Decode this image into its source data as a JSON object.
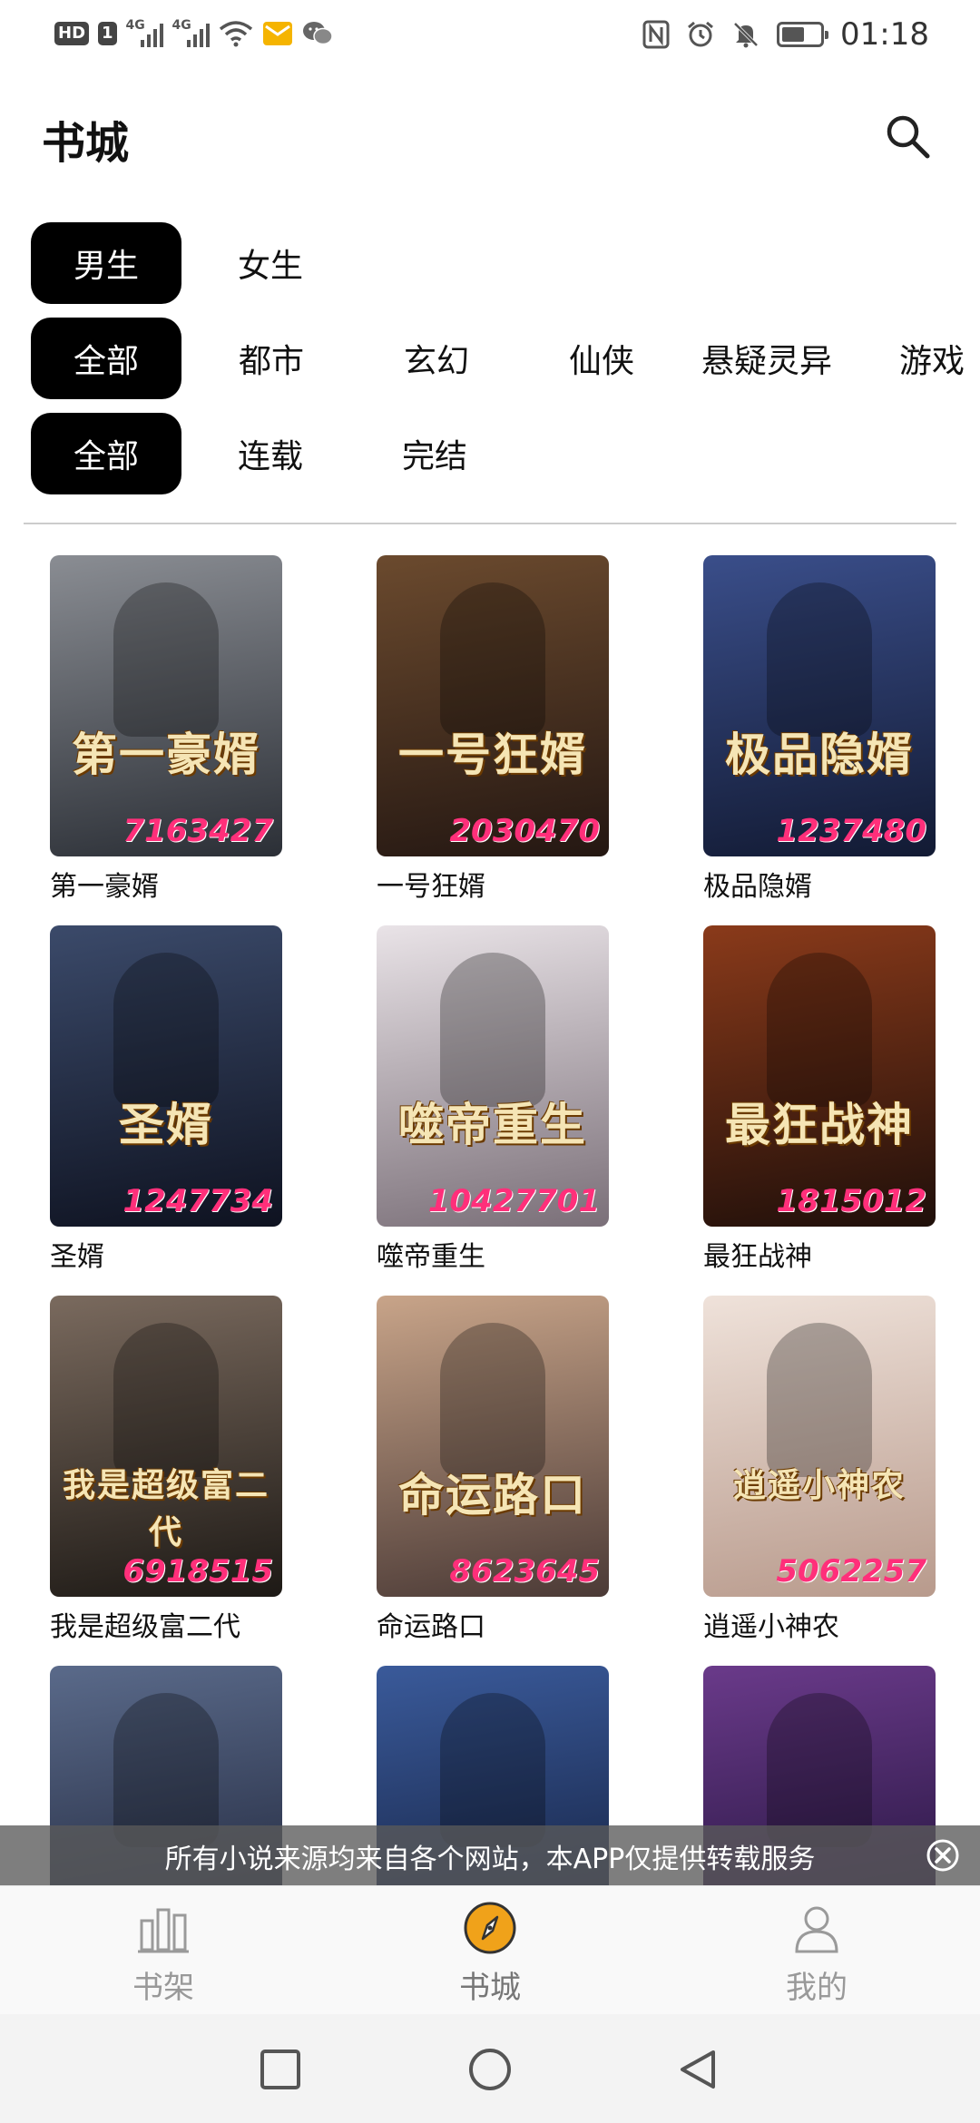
{
  "status_bar": {
    "left_badges": [
      "HD",
      "1"
    ],
    "signal_label": "4G",
    "time": "01:18",
    "icons": [
      "nfc-icon",
      "alarm-icon",
      "mute-bell-icon",
      "battery-icon"
    ],
    "battery_level": 0.6
  },
  "header": {
    "title": "书城",
    "search_icon": "search-icon"
  },
  "filters": {
    "gender": [
      {
        "label": "男生",
        "active": true
      },
      {
        "label": "女生",
        "active": false
      }
    ],
    "category": [
      {
        "label": "全部",
        "active": true
      },
      {
        "label": "都市",
        "active": false
      },
      {
        "label": "玄幻",
        "active": false
      },
      {
        "label": "仙侠",
        "active": false
      },
      {
        "label": "悬疑灵异",
        "active": false
      },
      {
        "label": "游戏",
        "active": false
      }
    ],
    "status": [
      {
        "label": "全部",
        "active": true
      },
      {
        "label": "连载",
        "active": false
      },
      {
        "label": "完结",
        "active": false
      }
    ]
  },
  "books": [
    {
      "title": "第一豪婿",
      "cover_title": "第一豪婿",
      "cover_id": "7163427",
      "colors": [
        "#8a8d93",
        "#2b2f36"
      ]
    },
    {
      "title": "一号狂婿",
      "cover_title": "一号狂婿",
      "cover_id": "2030470",
      "colors": [
        "#6b4a2e",
        "#241712"
      ]
    },
    {
      "title": "极品隐婿",
      "cover_title": "极品隐婿",
      "cover_id": "1237480",
      "colors": [
        "#3a4e8a",
        "#121a33"
      ]
    },
    {
      "title": "圣婿",
      "cover_title": "圣婿",
      "cover_id": "1247734",
      "colors": [
        "#3b4a6a",
        "#0e1220"
      ]
    },
    {
      "title": "噬帝重生",
      "cover_title": "噬帝重生",
      "cover_id": "10427701",
      "colors": [
        "#e9e3e7",
        "#7a6f78"
      ]
    },
    {
      "title": "最狂战神",
      "cover_title": "最狂战神",
      "cover_id": "1815012",
      "colors": [
        "#8a3a1a",
        "#1f0f0a"
      ]
    },
    {
      "title": "我是超级富二代",
      "cover_title": "我是超级富二代",
      "cover_id": "6918515",
      "colors": [
        "#7a6a5e",
        "#1d1915"
      ]
    },
    {
      "title": "命运路口",
      "cover_title": "命运路口",
      "cover_id": "8623645",
      "colors": [
        "#c8a489",
        "#4b3a36"
      ]
    },
    {
      "title": "逍遥小神农",
      "cover_title": "逍遥小神农",
      "cover_id": "5062257",
      "colors": [
        "#efe2da",
        "#b89a8c"
      ]
    },
    {
      "title": "",
      "cover_title": "",
      "cover_id": "",
      "colors": [
        "#5a6a8a",
        "#1a1f33"
      ]
    },
    {
      "title": "",
      "cover_title": "",
      "cover_id": "",
      "colors": [
        "#3a5a9a",
        "#101a36"
      ]
    },
    {
      "title": "",
      "cover_title": "",
      "cover_id": "",
      "colors": [
        "#6a3a8a",
        "#1a0f33"
      ]
    }
  ],
  "notice": {
    "text": "所有小说来源均来自各个网站，本APP仅提供转载服务",
    "close_icon": "close-circle-icon"
  },
  "bottom_nav": [
    {
      "label": "书架",
      "icon": "bookshelf-icon",
      "active": false
    },
    {
      "label": "书城",
      "icon": "compass-icon",
      "active": true,
      "accent": "#f0a21a"
    },
    {
      "label": "我的",
      "icon": "person-icon",
      "active": false
    }
  ],
  "system_nav": [
    "recent-square-icon",
    "home-circle-icon",
    "back-triangle-icon"
  ]
}
